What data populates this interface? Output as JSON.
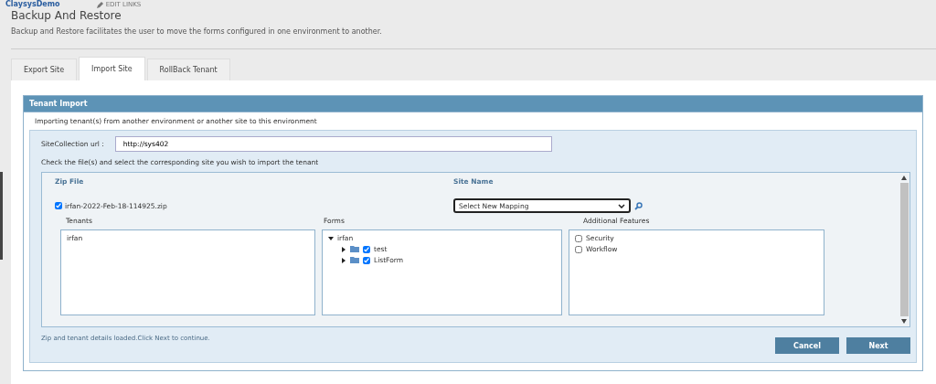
{
  "top_links": {
    "site": "ClaysysDemo",
    "edit": "EDIT LINKS"
  },
  "page": {
    "title": "Backup And Restore",
    "description": "Backup and Restore facilitates the user to move the forms configured in one environment to another."
  },
  "tabs": [
    {
      "label": "Export Site",
      "selected": false
    },
    {
      "label": "Import Site",
      "selected": true
    },
    {
      "label": "RollBack Tenant",
      "selected": false
    }
  ],
  "panel": {
    "title": "Tenant Import",
    "intro": "Importing tenant(s) from another environment or another site to this environment",
    "url_label": "SiteCollection url :",
    "url_value": "http://sys402",
    "instruction": "Check the file(s) and select the corresponding site you wish to import the tenant",
    "zip_heading": "Zip File",
    "site_heading": "Site Name",
    "zip_file": {
      "name": "irfan-2022-Feb-18-114925.zip",
      "checked": true
    },
    "site_select": "Select New Mapping",
    "tenants": {
      "heading": "Tenants",
      "items": [
        "irfan"
      ]
    },
    "forms": {
      "heading": "Forms",
      "tree": [
        {
          "label": "irfan",
          "expanded": true,
          "children": [
            {
              "label": "test",
              "expanded": false,
              "checked": true
            },
            {
              "label": "ListForm",
              "expanded": false,
              "checked": true
            }
          ]
        }
      ]
    },
    "features": {
      "heading": "Additional Features",
      "items": [
        {
          "label": "Security",
          "checked": false
        },
        {
          "label": "Workflow",
          "checked": false
        }
      ]
    },
    "status": "Zip and tenant details loaded.Click Next to continue.",
    "buttons": [
      "Cancel",
      "Next"
    ]
  }
}
